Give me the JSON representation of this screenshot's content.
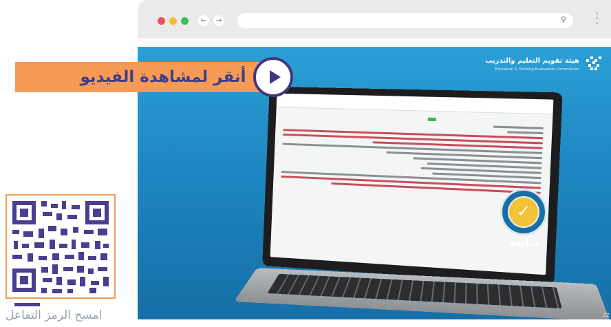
{
  "browser": {
    "window_controls": [
      "close",
      "minimize",
      "maximize"
    ],
    "nav_icons": [
      "back-icon",
      "forward-icon"
    ],
    "search_icon": "search-icon",
    "menu_icon": "more-vert-icon"
  },
  "video": {
    "org_title_ar": "هيئة تقويم التعليم والتدريب",
    "org_title_en": "Education & Training Evaluation Commission",
    "follow_label": "متابعة",
    "corner_tag": "ZZ"
  },
  "cta": {
    "watch_label": "أنقر لمشاهدة الفيديو",
    "play_icon": "play-icon"
  },
  "qr": {
    "label": "امسح الرمز التفاعل"
  },
  "colors": {
    "accent_orange": "#f59b55",
    "accent_purple": "#47357f",
    "video_blue": "#1d86c0",
    "follow_gold": "#f2c237",
    "dot_red": "#ee4e5a",
    "dot_yellow": "#f4bd3a",
    "dot_green": "#3ebe5a"
  }
}
